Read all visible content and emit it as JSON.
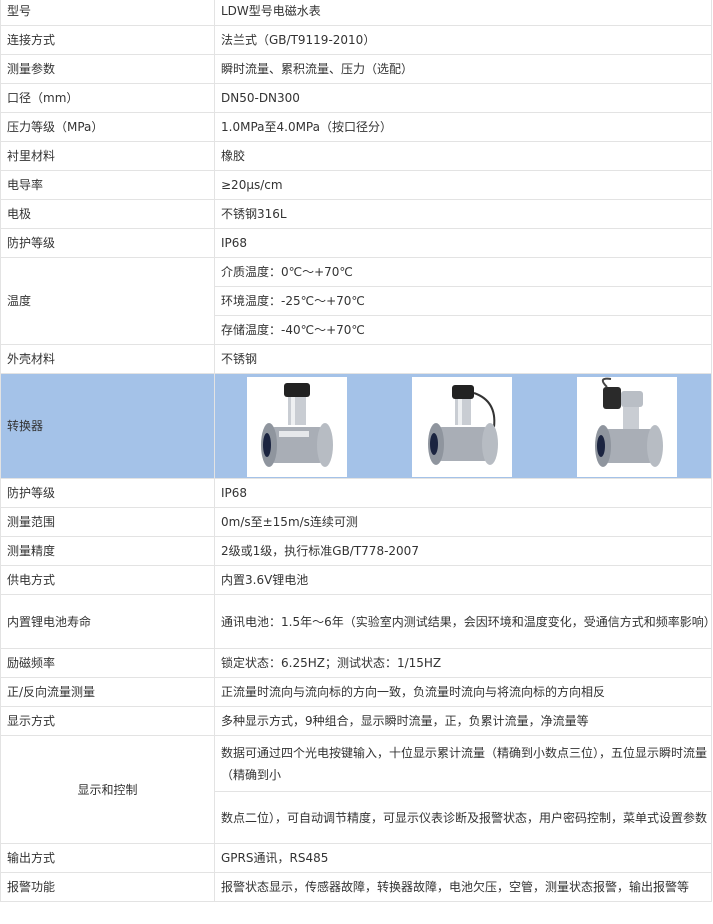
{
  "rows": [
    {
      "label": "型号",
      "value": "LDW型号电磁水表"
    },
    {
      "label": "连接方式",
      "value": "法兰式（GB/T9119-2010）"
    },
    {
      "label": "测量参数",
      "value": "瞬时流量、累积流量、压力（选配）"
    },
    {
      "label": "口径（mm）",
      "value": "DN50-DN300"
    },
    {
      "label": "压力等级（MPa）",
      "value": "1.0MPa至4.0MPa（按口径分）"
    },
    {
      "label": "衬里材料",
      "value": "橡胶"
    },
    {
      "label": "电导率",
      "value": "≥20μs/cm"
    },
    {
      "label": "电极",
      "value": "不锈钢316L"
    },
    {
      "label": "防护等级",
      "value": "IP68"
    }
  ],
  "temperature": {
    "label": "温度",
    "values": [
      "介质温度：0℃～+70℃",
      "环境温度：-25℃～+70℃",
      "存储温度：-40℃～+70℃"
    ]
  },
  "housing": {
    "label": "外壳材料",
    "value": "不锈钢"
  },
  "converter": {
    "label": "转换器"
  },
  "rows2": [
    {
      "label": "防护等级",
      "value": "IP68"
    },
    {
      "label": "测量范围",
      "value": "0m/s至±15m/s连续可测"
    },
    {
      "label": "测量精度",
      "value": "2级或1级，执行标准GB/T778-2007"
    },
    {
      "label": "供电方式",
      "value": "内置3.6V锂电池"
    }
  ],
  "battery": {
    "label": "内置锂电池寿命",
    "value": "通讯电池：1.5年～6年（实验室内测试结果，会因环境和温度变化，受通信方式和频率影响）"
  },
  "rows3": [
    {
      "label": "励磁频率",
      "value": "锁定状态：6.25HZ；测试状态：1/15HZ"
    },
    {
      "label": "正/反向流量测量",
      "value": "正流量时流向与流向标的方向一致，负流量时流向与将流向标的方向相反"
    },
    {
      "label": "显示方式",
      "value": "多种显示方式，9种组合，显示瞬时流量，正，负累计流量，净流量等"
    }
  ],
  "display_control": {
    "label": "显示和控制",
    "value1": "数据可通过四个光电按键输入，十位显示累计流量（精确到小数点三位），五位显示瞬时流量（精确到小",
    "value2": "数点二位），可自动调节精度，可显示仪表诊断及报警状态，用户密码控制，菜单式设置参数"
  },
  "rows4": [
    {
      "label": "输出方式",
      "value": "GPRS通讯，RS485"
    },
    {
      "label": "报警功能",
      "value": "报警状态显示，传感器故障，转换器故障，电池欠压，空管，测量状态报警，输出报警等"
    }
  ]
}
